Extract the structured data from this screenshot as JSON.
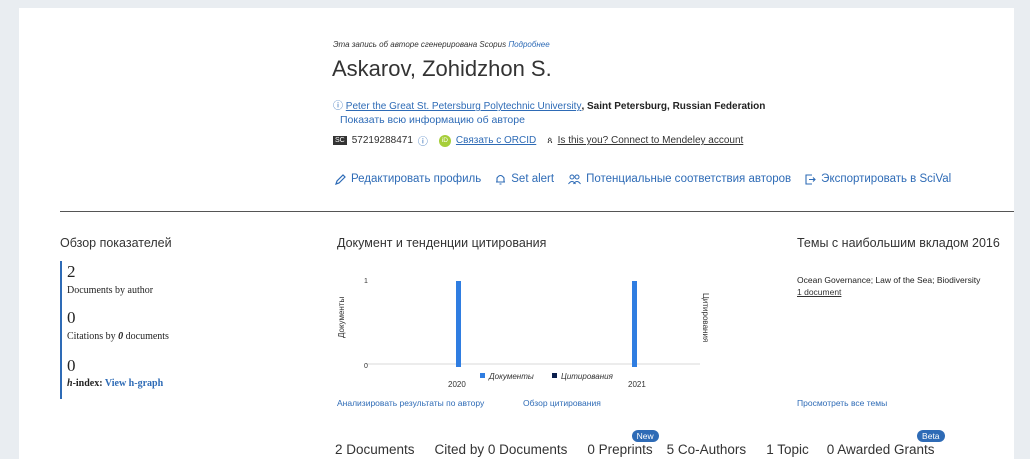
{
  "profile": {
    "record_note": "Эта запись об авторе сгенерирована Scopus",
    "record_link": "Подробнее",
    "name": "Askarov, Zohidzhon S.",
    "affiliation": "Peter the Great St. Petersburg Polytechnic University",
    "location": ", Saint Petersburg, Russian Federation",
    "show_all": "Показать всю информацию об авторе",
    "scopus_id_badge": "SC",
    "scopus_id": "57219288471",
    "orcid_badge": "iD",
    "orcid_link": "Связать с ORCID",
    "mendeley_link": "Is this you? Connect to Mendeley account"
  },
  "actions": {
    "edit": "Редактировать профиль",
    "alert": "Set alert",
    "matches": "Потенциальные соответствия авторов",
    "export": "Экспортировать в SciVal"
  },
  "metrics": {
    "title": "Обзор показателей",
    "documents_value": "2",
    "documents_label": "Documents by author",
    "citations_value": "0",
    "citations_label_pre": "Citations by ",
    "citations_label_bold": "0",
    "citations_label_post": " documents",
    "hindex_value": "0",
    "hindex_label_h": "h",
    "hindex_label_mid": "-index: ",
    "hindex_link": "View h-graph"
  },
  "trends": {
    "title": "Документ и тенденции цитирования",
    "analyze_link": "Анализировать результаты по автору",
    "citation_overview_link": "Обзор цитирования"
  },
  "chart_data": {
    "type": "bar",
    "categories": [
      "2020",
      "2021"
    ],
    "series": [
      {
        "name": "Документы",
        "values": [
          1,
          1
        ],
        "color": "#2f7de1"
      },
      {
        "name": "Цитирования",
        "values": [
          0,
          0
        ],
        "color": "#0b1f4d"
      }
    ],
    "ylabel": "Документы",
    "y2label": "Цитирования",
    "y_ticks": [
      "1",
      "0"
    ],
    "y2_ticks": [
      "0"
    ],
    "ylim": [
      0,
      1
    ]
  },
  "topics": {
    "title": "Темы с наибольшим вкладом 2016",
    "topic_name": "Ocean Governance; Law of the Sea; Biodiversity",
    "topic_docs": "1 document",
    "view_all": "Просмотреть все темы"
  },
  "tabs": [
    {
      "label": "2 Documents",
      "badge": ""
    },
    {
      "label": "Cited by 0 Documents",
      "badge": ""
    },
    {
      "label": "0 Preprints",
      "badge": "New"
    },
    {
      "label": "5 Co-Authors",
      "badge": ""
    },
    {
      "label": "1 Topic",
      "badge": ""
    },
    {
      "label": "0 Awarded Grants",
      "badge": "Beta"
    }
  ],
  "colors": {
    "accent": "#2e6bb6",
    "bar_docs": "#2f7de1",
    "bar_cites": "#0b1f4d"
  }
}
